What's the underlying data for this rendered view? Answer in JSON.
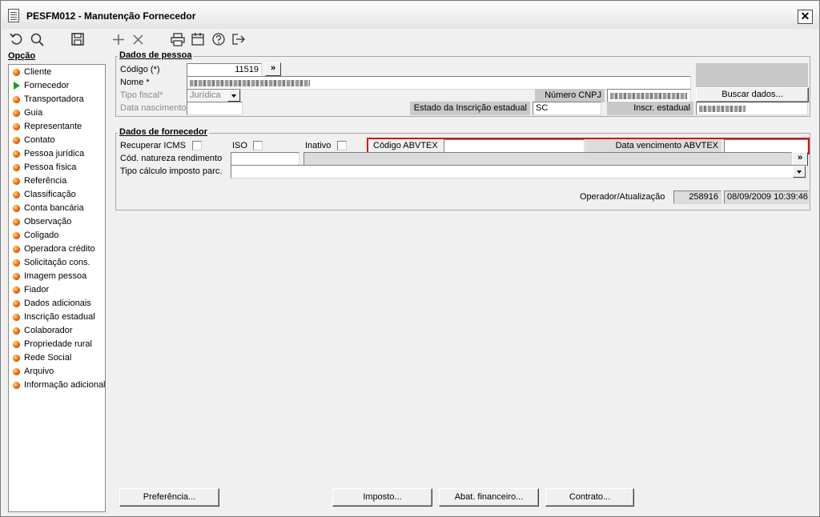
{
  "window": {
    "title": "PESFM012 - Manutenção Fornecedor",
    "close_label": "✕"
  },
  "toolbar": {
    "icons": [
      "undo-icon",
      "search-icon",
      "save-icon",
      "add-icon",
      "delete-icon",
      "print-icon",
      "calendar-icon",
      "help-icon",
      "exit-icon"
    ]
  },
  "sidebar": {
    "title": "Opção",
    "items": [
      {
        "label": "Cliente",
        "icon": "orange-dot-icon"
      },
      {
        "label": "Fornecedor",
        "icon": "green-arrow-icon"
      },
      {
        "label": "Transportadora",
        "icon": "orange-dot-icon"
      },
      {
        "label": "Guia",
        "icon": "orange-dot-icon"
      },
      {
        "label": "Representante",
        "icon": "orange-dot-icon"
      },
      {
        "label": "Contato",
        "icon": "orange-dot-icon"
      },
      {
        "label": "Pessoa jurídica",
        "icon": "orange-dot-icon"
      },
      {
        "label": "Pessoa física",
        "icon": "orange-dot-icon"
      },
      {
        "label": "Referência",
        "icon": "orange-dot-icon"
      },
      {
        "label": "Classificação",
        "icon": "orange-dot-icon"
      },
      {
        "label": "Conta bancária",
        "icon": "orange-dot-icon"
      },
      {
        "label": "Observação",
        "icon": "orange-dot-icon"
      },
      {
        "label": "Coligado",
        "icon": "orange-dot-icon"
      },
      {
        "label": "Operadora crédito",
        "icon": "orange-dot-icon"
      },
      {
        "label": "Solicitação cons.",
        "icon": "orange-dot-icon"
      },
      {
        "label": "Imagem pessoa",
        "icon": "orange-dot-icon"
      },
      {
        "label": "Fiador",
        "icon": "orange-dot-icon"
      },
      {
        "label": "Dados adicionais",
        "icon": "orange-dot-icon"
      },
      {
        "label": "Inscrição estadual",
        "icon": "orange-dot-icon"
      },
      {
        "label": "Colaborador",
        "icon": "orange-dot-icon"
      },
      {
        "label": "Propriedade rural",
        "icon": "orange-dot-icon"
      },
      {
        "label": "Rede Social",
        "icon": "orange-dot-icon"
      },
      {
        "label": "Arquivo",
        "icon": "orange-dot-icon"
      },
      {
        "label": "Informação adicional",
        "icon": "orange-dot-icon"
      }
    ]
  },
  "pessoa": {
    "legend": "Dados de pessoa",
    "codigo_label": "Código (*)",
    "codigo_value": "11519",
    "nome_label": "Nome *",
    "tipo_fiscal_label": "Tipo fiscal*",
    "tipo_fiscal_value": "Jurídica",
    "data_nascimento_label": "Data nascimento",
    "cnpj_label": "Número CNPJ",
    "estado_ie_label": "Estado da Inscrição estadual",
    "estado_ie_value": "SC",
    "inscr_estadual_label": "Inscr. estadual",
    "buscar_label": "Buscar dados..."
  },
  "fornecedor": {
    "legend": "Dados de fornecedor",
    "recuperar_icms_label": "Recuperar ICMS",
    "iso_label": "ISO",
    "inativo_label": "Inativo",
    "codigo_abvtex_label": "Código ABVTEX",
    "data_venc_abvtex_label": "Data vencimento ABVTEX",
    "cod_natureza_label": "Cód. natureza rendimento",
    "tipo_calculo_label": "Tipo cálculo imposto parc.",
    "operador_label": "Operador/Atualização",
    "operador_value": "258916",
    "atualizacao_value": "08/09/2009 10:39:46"
  },
  "buttons": {
    "preferencia": "Preferência...",
    "imposto": "Imposto...",
    "abat_financeiro": "Abat. financeiro...",
    "contrato": "Contrato...",
    "lookup": "»"
  },
  "colors": {
    "highlight": "#d4141c",
    "panel": "#f0f0f0",
    "label_bg": "#c8c8c8"
  }
}
